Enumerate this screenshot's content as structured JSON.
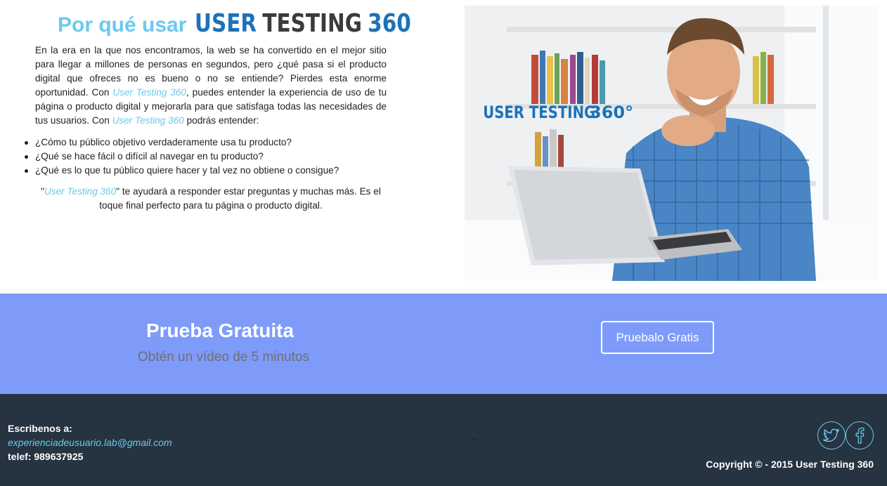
{
  "header": {
    "title_prefix": "Por qué usar",
    "brand": {
      "user": "USER",
      "testing": "TESTING",
      "number": "360"
    }
  },
  "intro": {
    "p1_a": "En la era en la que nos encontramos, la web se ha convertido en el mejor sitio para llegar a millones de personas en segundos, pero ¿qué pasa si el producto digital que ofreces no es bueno o no se entiende? Pierdes esta enorme oportunidad. Con ",
    "p1_brand": "User Testing 360",
    "p1_b": ", puedes entender la experiencia de uso de tu página o producto digital y mejorarla para que satisfaga todas las necesidades de tus usuarios. Con ",
    "p1_brand2": "User Testing 360",
    "p1_c": " podrás entender:"
  },
  "bullets": [
    "¿Cómo tu público objetivo verdaderamente usa tu producto?",
    "¿Qué se hace fácil o difícil al navegar en tu producto?",
    "¿Qué es lo que tu público quiere hacer y tal vez no obtiene o consigue?"
  ],
  "closing": {
    "quote_open": "\"",
    "brand": "User Testing 360",
    "text": "\" te ayudará a responder estar preguntas y muchas más. Es el toque final perfecto para tu página o producto digital."
  },
  "hero": {
    "logo_user": "USER TESTING",
    "logo_num": "360°"
  },
  "cta_band": {
    "title": "Prueba Gratuita",
    "subtitle": "Obtén un vídeo de 5 minutos",
    "button_label": "Pruebalo Gratis"
  },
  "footer": {
    "label": "Escribenos a:",
    "email": "experienciadeusuario.lab@gmail.com",
    "phone": "telef: 989637925",
    "scroll_up": "⌃",
    "copyright": "Copyright © - 2015 User Testing 360"
  },
  "colors": {
    "accent": "#6cc8ee",
    "brand_blue": "#1d72b8",
    "band": "#7e9bfa",
    "footer": "#263340"
  },
  "icons": [
    "twitter-icon",
    "facebook-icon"
  ]
}
